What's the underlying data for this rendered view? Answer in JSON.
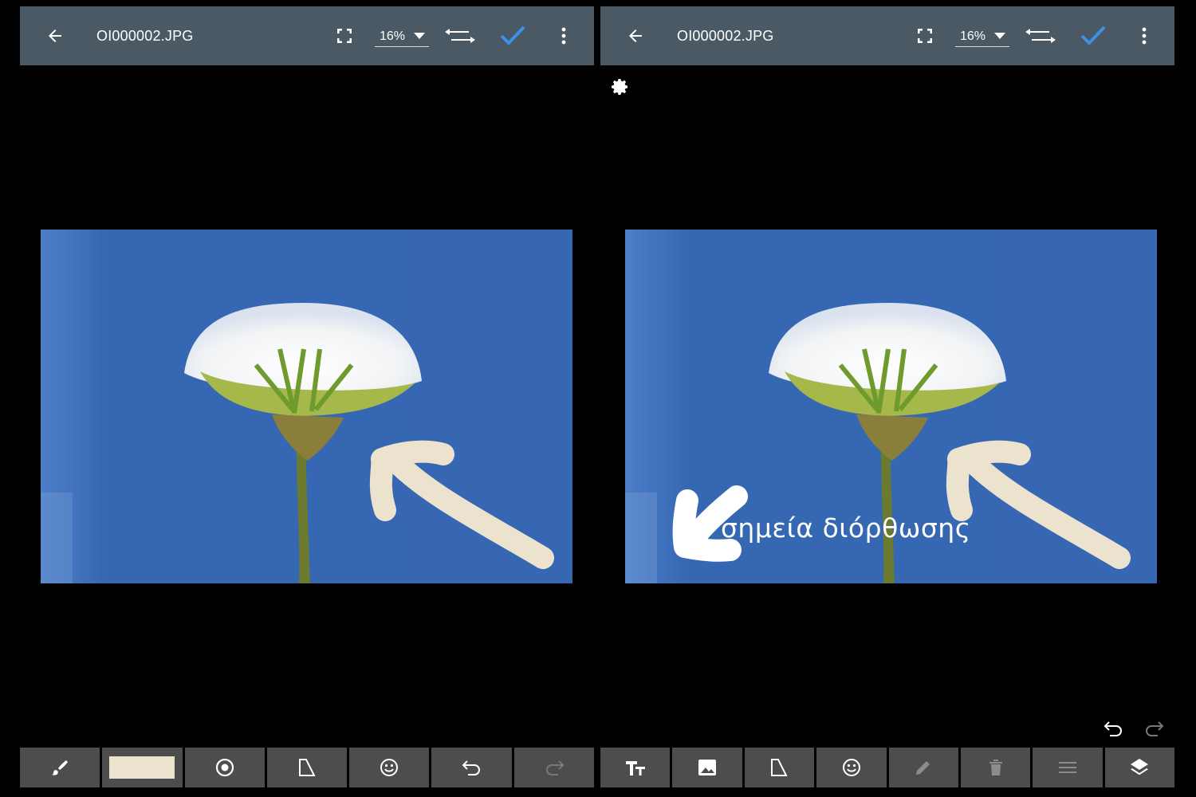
{
  "left_editor": {
    "title": "OI000002.JPG",
    "zoom": "16%",
    "brush_color": "#ece3cf",
    "toolbar": [
      "brush-icon",
      "color-swatch",
      "circle-icon",
      "shape-icon",
      "emoji-icon",
      "undo-icon",
      "redo-icon"
    ]
  },
  "right_editor": {
    "title": "OI000002.JPG",
    "zoom": "16%",
    "overlay_text": "σημεία διόρθωσης",
    "toolbar": [
      "text-size-icon",
      "image-icon",
      "shape-icon",
      "emoji-icon",
      "pencil-icon",
      "trash-icon",
      "menu-lines-icon",
      "layers-icon"
    ]
  },
  "colors": {
    "appbar": "#4a5963",
    "sky": "#3667b3",
    "accent_check": "#3d8fe8",
    "toolbar_bg": "#4d4d4d",
    "annotation_arrow": "#ece3cf"
  }
}
